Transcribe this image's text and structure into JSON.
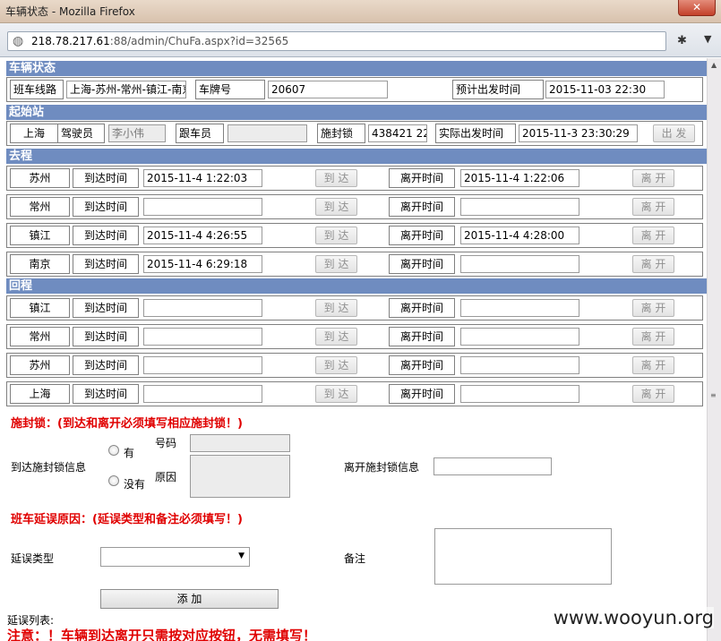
{
  "window": {
    "title": "车辆状态 - Mozilla Firefox",
    "url_host": "218.78.217.61",
    "url_rest": ":88/admin/ChuFa.aspx?id=32565"
  },
  "status": {
    "header": "车辆状态",
    "line_label": "班车线路",
    "line_value": "上海-苏州-常州-镇江-南京",
    "plate_label": "车牌号",
    "plate_value": "20607",
    "plan_label": "预计出发时间",
    "plan_value": "2015-11-03 22:30"
  },
  "origin": {
    "header": "起始站",
    "station": "上海",
    "driver_label": "驾驶员",
    "driver_value": "李小伟",
    "escort_label": "跟车员",
    "escort_value": "",
    "seal_label": "施封锁",
    "seal_value": "438421  22",
    "actual_label": "实际出发时间",
    "actual_value": "2015-11-3 23:30:29",
    "depart_button": "出 发"
  },
  "labels": {
    "arrive_time": "到达时间",
    "leave_time": "离开时间",
    "arrive_button": "到 达",
    "leave_button": "离 开"
  },
  "outbound": {
    "header": "去程",
    "rows": [
      {
        "station": "苏州",
        "arrive": "2015-11-4 1:22:03",
        "leave": "2015-11-4 1:22:06"
      },
      {
        "station": "常州",
        "arrive": "",
        "leave": ""
      },
      {
        "station": "镇江",
        "arrive": "2015-11-4 4:26:55",
        "leave": "2015-11-4 4:28:00"
      },
      {
        "station": "南京",
        "arrive": "2015-11-4 6:29:18",
        "leave": ""
      }
    ]
  },
  "return": {
    "header": "回程",
    "rows": [
      {
        "station": "镇江",
        "arrive": "",
        "leave": ""
      },
      {
        "station": "常州",
        "arrive": "",
        "leave": ""
      },
      {
        "station": "苏州",
        "arrive": "",
        "leave": ""
      },
      {
        "station": "上海",
        "arrive": "",
        "leave": ""
      }
    ]
  },
  "seal": {
    "title": "施封锁：(到达和离开必须填写相应施封锁！)",
    "arrive_info_label": "到达施封锁信息",
    "option_yes": "有",
    "option_no": "没有",
    "number_label": "号码",
    "reason_label": "原因",
    "leave_info_label": "离开施封锁信息"
  },
  "delay": {
    "title": "班车延误原因：(延误类型和备注必须填写！)",
    "type_label": "延误类型",
    "type_value": "",
    "remark_label": "备注",
    "add_button": "添 加",
    "list_label": "延误列表:",
    "notice": "注意：！车辆到达离开只需按对应按钮，无需填写！"
  },
  "watermark": "www.wooyun.org"
}
